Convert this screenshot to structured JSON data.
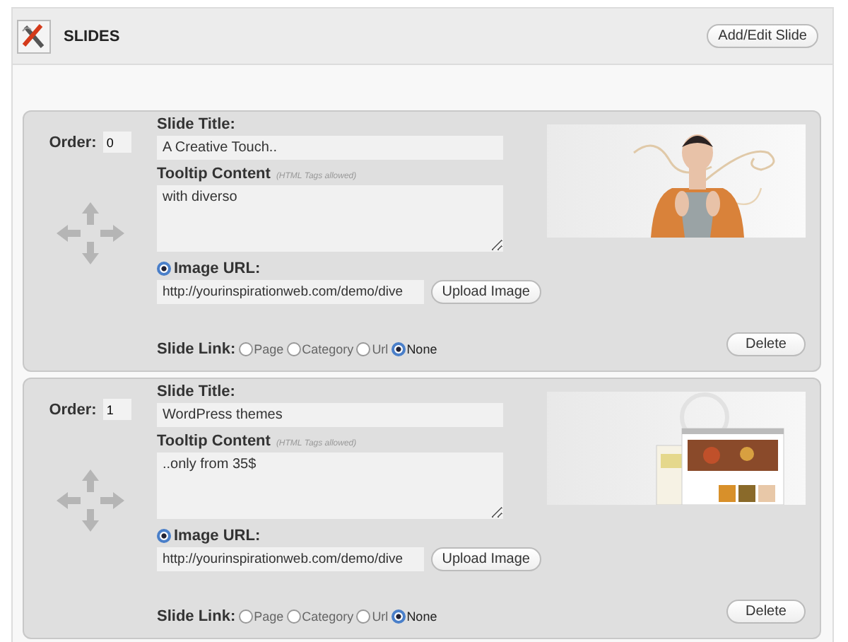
{
  "header": {
    "title": "SLIDES",
    "button": "Add/Edit Slide"
  },
  "slides": [
    {
      "order_label": "Order:",
      "order": "0",
      "title_label": "Slide Title:",
      "title": "A Creative Touch..",
      "tooltip_label": "Tooltip Content",
      "tooltip_hint": "(HTML Tags allowed)",
      "tooltip": "with diverso",
      "image_url_label": "Image URL:",
      "image_url_selected": true,
      "image_url": "http://yourinspirationweb.com/demo/dive",
      "upload_button": "Upload Image",
      "link_label": "Slide Link:",
      "link_options": [
        {
          "label": "Page",
          "selected": false
        },
        {
          "label": "Category",
          "selected": false
        },
        {
          "label": "Url",
          "selected": false
        },
        {
          "label": "None",
          "selected": true
        }
      ],
      "delete_button": "Delete",
      "picture": {
        "kind": "figure"
      }
    },
    {
      "order_label": "Order:",
      "order": "1",
      "title_label": "Slide Title:",
      "title": "WordPress themes",
      "tooltip_label": "Tooltip Content",
      "tooltip_hint": "(HTML Tags allowed)",
      "tooltip": "..only from 35$",
      "image_url_label": "Image URL:",
      "image_url_selected": true,
      "image_url": "http://yourinspirationweb.com/demo/dive",
      "upload_button": "Upload Image",
      "link_label": "Slide Link:",
      "link_options": [
        {
          "label": "Page",
          "selected": false
        },
        {
          "label": "Category",
          "selected": false
        },
        {
          "label": "Url",
          "selected": false
        },
        {
          "label": "None",
          "selected": true
        }
      ],
      "delete_button": "Delete",
      "picture": {
        "kind": "website"
      }
    }
  ]
}
